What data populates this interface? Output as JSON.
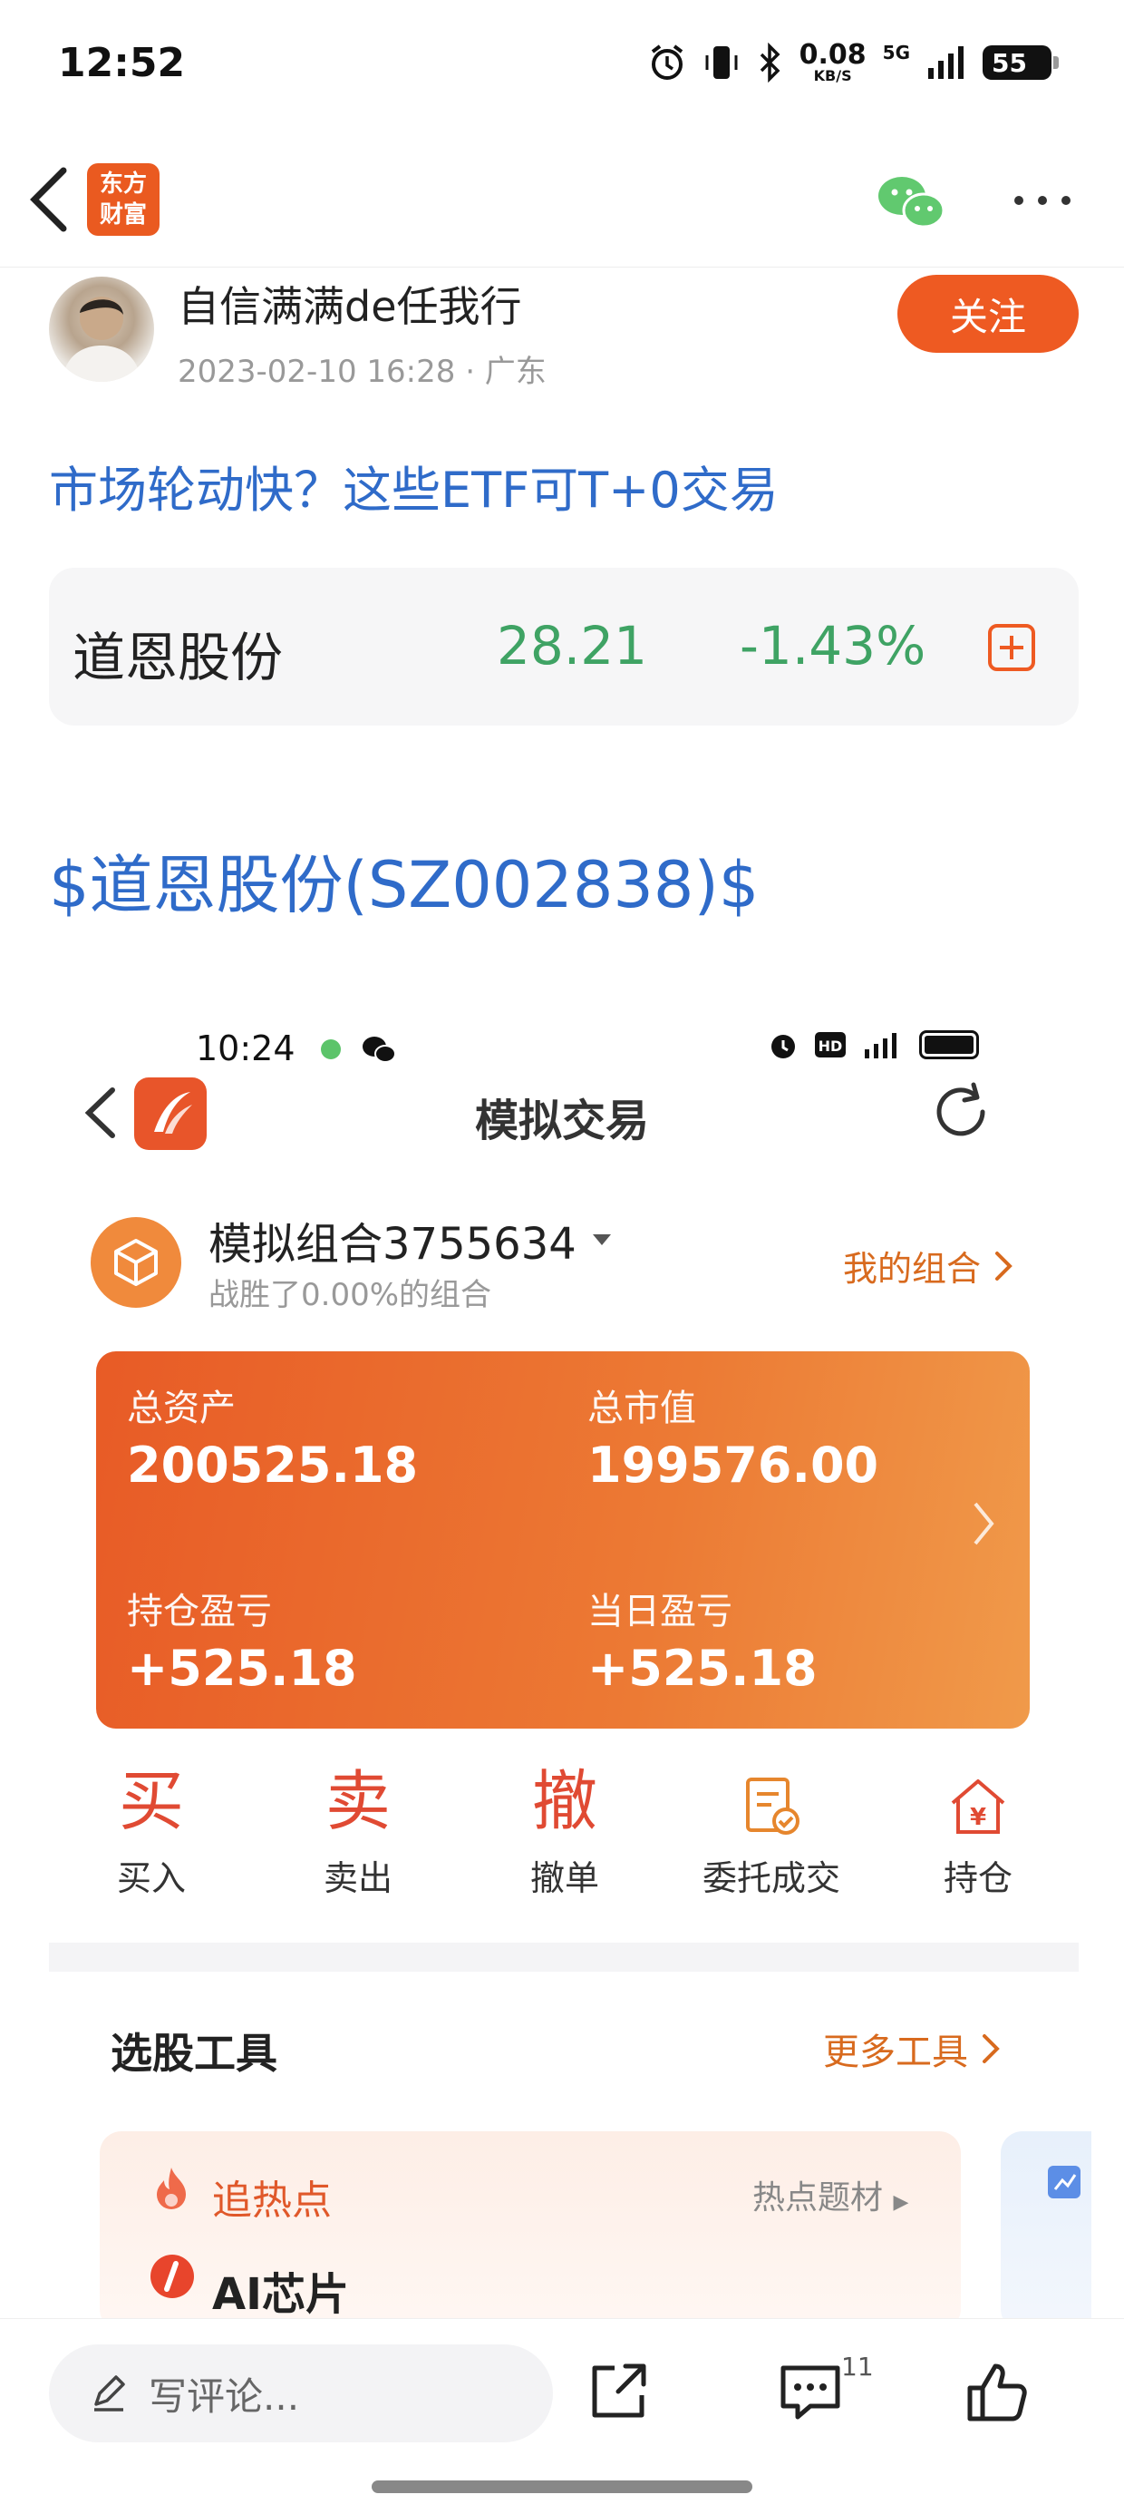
{
  "status_bar": {
    "time": "12:52",
    "net_speed_value": "0.08",
    "net_speed_unit": "KB/S",
    "network": "5G",
    "battery": "55"
  },
  "nav": {
    "logo_text_line1": "东方",
    "logo_text_line2": "财富"
  },
  "author": {
    "name": "自信满满de任我行",
    "meta": "2023-02-10 16:28 · 广东",
    "follow_label": "关注"
  },
  "article": {
    "title": "市场轮动快？这些ETF可T+0交易",
    "stock_tag": "$道恩股份(SZ002838)$"
  },
  "stock_card": {
    "name": "道恩股份",
    "price": "28.21",
    "change": "-1.43%",
    "change_color": "#3fa364"
  },
  "embedded": {
    "status_time": "10:24",
    "title": "模拟交易",
    "combo_name": "模拟组合3755634",
    "combo_sub": "战胜了0.00%的组合",
    "my_combo": "我的组合",
    "assets": {
      "total_assets_label": "总资产",
      "total_assets_value": "200525.18",
      "market_value_label": "总市值",
      "market_value_value": "199576.00",
      "position_pnl_label": "持仓盈亏",
      "position_pnl_value": "+525.18",
      "daily_pnl_label": "当日盈亏",
      "daily_pnl_value": "+525.18"
    },
    "actions": [
      {
        "glyph": "买",
        "label": "买入"
      },
      {
        "glyph": "卖",
        "label": "卖出"
      },
      {
        "glyph": "撤",
        "label": "撤单"
      },
      {
        "glyph": "",
        "label": "委托成交"
      },
      {
        "glyph": "",
        "label": "持仓"
      }
    ],
    "tools_title": "选股工具",
    "more_tools": "更多工具",
    "hot": {
      "title": "追热点",
      "link": "热点题材",
      "item": "AI芯片"
    }
  },
  "bottom_bar": {
    "comment_placeholder": "写评论...",
    "comment_count": "11"
  },
  "colors": {
    "accent_orange": "#ee5a22",
    "link_blue": "#2f6bc9",
    "price_green": "#3fa364"
  }
}
